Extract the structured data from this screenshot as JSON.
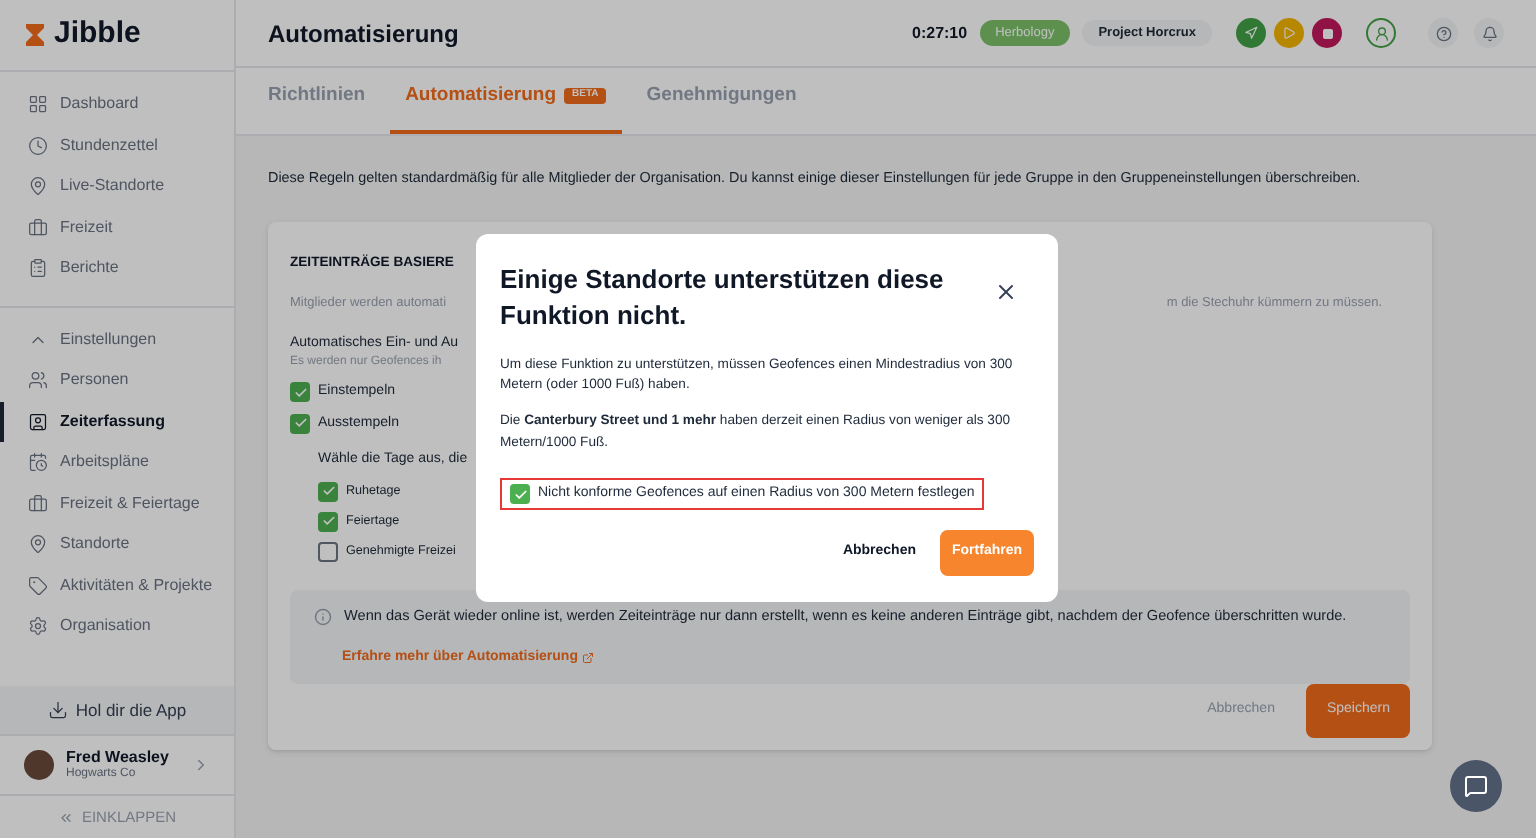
{
  "sidebar": {
    "logo": "Jibble",
    "items": [
      {
        "label": "Dashboard",
        "selected": false
      },
      {
        "label": "Stundenzettel",
        "selected": false
      },
      {
        "label": "Live-Standorte",
        "selected": false
      },
      {
        "label": "Freizeit",
        "selected": false
      },
      {
        "label": "Berichte",
        "selected": false
      }
    ],
    "settings": {
      "label": "Einstellungen",
      "expanded": true,
      "items": [
        {
          "label": "Personen",
          "selected": false
        },
        {
          "label": "Zeiterfassung",
          "selected": true
        },
        {
          "label": "Arbeitspläne",
          "selected": false
        },
        {
          "label": "Freizeit & Feiertage",
          "selected": false
        },
        {
          "label": "Standorte",
          "selected": false
        },
        {
          "label": "Aktivitäten & Projekte",
          "selected": false
        },
        {
          "label": "Organisation",
          "selected": false
        }
      ]
    },
    "get_app": "Hol dir die App",
    "user": {
      "name": "Fred Weasley",
      "org": "Hogwarts Co"
    },
    "collapse": "EINKLAPPEN"
  },
  "header": {
    "title": "Automatisierung",
    "timer": "0:27:10",
    "activity": "Herbology",
    "project": "Project Horcrux"
  },
  "tabs": [
    {
      "label": "Richtlinien",
      "selected": false
    },
    {
      "label": "Automatisierung",
      "badge": "BETA",
      "selected": true
    },
    {
      "label": "Genehmigungen",
      "selected": false
    }
  ],
  "description": "Diese Regeln gelten standardmäßig für alle Mitglieder der Organisation. Du kannst einige dieser Einstellungen für jede Gruppe in den Gruppeneinstellungen überschreiben.",
  "card": {
    "title": "ZEITEINTRÄGE BASIERE",
    "subtitle": "Mitglieder werden automati",
    "subtitle_end": "m die Stechuhr kümmern zu müssen.",
    "auto_label": "Automatisches Ein- und Au",
    "auto_hint": "Es werden nur Geofences ih",
    "options": [
      {
        "label": "Einstempeln",
        "checked": true
      },
      {
        "label": "Ausstempeln",
        "checked": true
      }
    ],
    "days_label": "Wähle die Tage aus, die",
    "days": [
      {
        "label": "Ruhetage",
        "checked": true
      },
      {
        "label": "Feiertage",
        "checked": true
      },
      {
        "label": "Genehmigte Freizei",
        "checked": false
      }
    ],
    "info": "Wenn das Gerät wieder online ist, werden Zeiteinträge nur dann erstellt, wenn es keine anderen Einträge gibt, nachdem der Geofence überschritten wurde.",
    "link": "Erfahre mehr über Automatisierung",
    "cancel": "Abbrechen",
    "save": "Speichern"
  },
  "dialog": {
    "title": "Einige Standorte unterstützen diese Funktion nicht.",
    "text_1": "Um diese Funktion zu unterstützen, müssen Geofences einen Mindestradius von 300 Metern (oder 1000 Fuß) haben.",
    "text_2": "Die **Canterbury Street und 1 mehr** haben derzeit einen Radius von weniger als 300 Metern/1000 Fuß.",
    "checkbox": {
      "label": "Nicht konforme Geofences auf einen Radius von 300 Metern festlegen",
      "checked": true
    },
    "cancel": "Abbrechen",
    "confirm": "Fortfahren"
  }
}
